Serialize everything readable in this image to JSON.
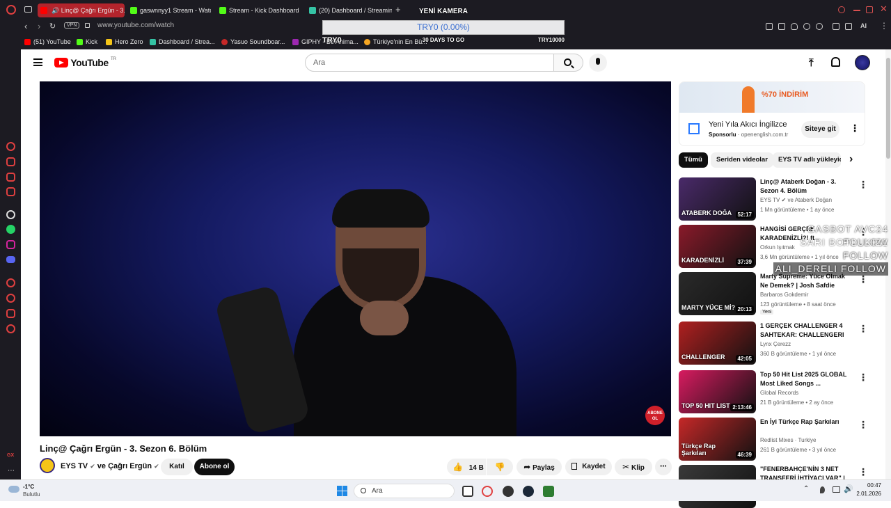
{
  "tabs": [
    {
      "label": "Linç@ Çağrı Ergün - 3.",
      "color": "#ff0000"
    },
    {
      "label": "gaswnnyy1 Stream - Watc",
      "color": "#53fc18"
    },
    {
      "label": "Stream - Kick Dashboard",
      "color": "#53fc18"
    },
    {
      "label": "(20) Dashboard / Streamin",
      "color": "#35c3a5"
    }
  ],
  "new_tab": "+",
  "address": {
    "vpn": "VPN",
    "url": "www.youtube.com/watch",
    "ai": "AI"
  },
  "bookmarks": [
    {
      "label": "(51) YouTube",
      "color": "#ff0000"
    },
    {
      "label": "Kick",
      "color": "#53fc18"
    },
    {
      "label": "Hero Zero",
      "color": "#f5c518"
    },
    {
      "label": "Dashboard / Strea...",
      "color": "#35c3a5"
    },
    {
      "label": "Yasuo Soundboar...",
      "color": "#c62828"
    },
    {
      "label": "GIPHY - Be Anima...",
      "color": "#9c27b0"
    },
    {
      "label": "Türkiye'nin En Bü...",
      "color": "#f5a623"
    }
  ],
  "camera_overlay": {
    "title": "YENİ KAMERA",
    "bar": "TRY0 (0.00%)",
    "left": "TRY0",
    "center": "30 DAYS TO GO",
    "right": "TRY10000"
  },
  "follow_overlay": [
    "GASBOT AVC24  FOLLOW",
    "SARI BOTLUKIZ1  FOLLOW",
    "FOLLOW",
    "ALI_DERELI  FOLLOW"
  ],
  "youtube": {
    "logo": "YouTube",
    "region": "TR",
    "search_placeholder": "Ara",
    "video": {
      "title": "Linç@ Çağrı Ergün - 3. Sezon 6. Bölüm",
      "channel": "EYS TV",
      "collab": "ve Çağrı Ergün",
      "join": "Katıl",
      "subscribe": "Abone ol",
      "likes": "14 B",
      "share": "Paylaş",
      "save": "Kaydet",
      "clip": "Klip",
      "watermark": "ABONE OL"
    },
    "ad": {
      "banner": "%70 İNDİRİM",
      "title": "Yeni Yıla Akıcı İngilizce",
      "sponsor": "Sponsorlu",
      "domain": "openenglish.com.tr",
      "cta": "Siteye git"
    },
    "chips": [
      "Tümü",
      "Seriden videolar",
      "EYS TV adlı yükleyici"
    ],
    "recommendations": [
      {
        "title": "Linç@ Ataberk Doğan - 3. Sezon 4. Bölüm",
        "channel": "EYS TV ✔ ve Ataberk Doğan",
        "meta": "1 Mn görüntüleme • 1 ay önce",
        "duration": "52:17",
        "thumb_color": "#4a2a6a",
        "thumb_text": "ATABERK DOĞA"
      },
      {
        "title": "HANGİSİ GERÇEK KARADENİZLİ?! ft...",
        "channel": "Orkun Işıtmak",
        "meta": "3,6 Mn görüntüleme • 1 yıl önce",
        "duration": "37:39",
        "thumb_color": "#8a1a2a",
        "thumb_text": "KARADENİZLİ"
      },
      {
        "title": "Marty Supreme: Yüce Olmak Ne Demek? | Josh Safdie Solo ...",
        "channel": "Barbaros Gokdemir",
        "meta": "123 görüntüleme • 8 saat önce",
        "duration": "20:13",
        "thumb_color": "#2a2a2a",
        "thumb_text": "MARTY YÜCE Mİ?",
        "badge": "Yeni"
      },
      {
        "title": "1 GERÇEK CHALLENGER 4 SAHTEKAR: CHALLENGERI ...",
        "channel": "Lynx Çerezz",
        "meta": "360 B görüntüleme • 1 yıl önce",
        "duration": "42:05",
        "thumb_color": "#b02020",
        "thumb_text": "CHALLENGER"
      },
      {
        "title": "Top 50 Hit List 2025 GLOBAL Most Liked Songs ...",
        "channel": "Global Records",
        "meta": "21 B görüntüleme • 2 ay önce",
        "duration": "2:13:46",
        "thumb_color": "#d81b60",
        "thumb_text": "TOP 50 HIT LIST"
      },
      {
        "title": "En İyi Türkçe Rap Şarkıları",
        "channel": "Redlist Mixes · Turkiye",
        "meta": "261 B görüntüleme • 3 yıl önce",
        "duration": "46:39",
        "thumb_color": "#c62828",
        "thumb_text": "Türkçe Rap Şarkıları"
      },
      {
        "title": "\"FENERBAHÇE'NİN 3 NET TRANSFERİ İHTİYACI VAR\" |",
        "channel": "",
        "meta": "",
        "duration": "",
        "thumb_color": "#3a3a3a",
        "thumb_text": ""
      }
    ]
  },
  "taskbar": {
    "weather_temp": "-1°C",
    "weather_desc": "Bulutlu",
    "search": "Ara",
    "time": "00:47",
    "date": "2.01.2026"
  }
}
